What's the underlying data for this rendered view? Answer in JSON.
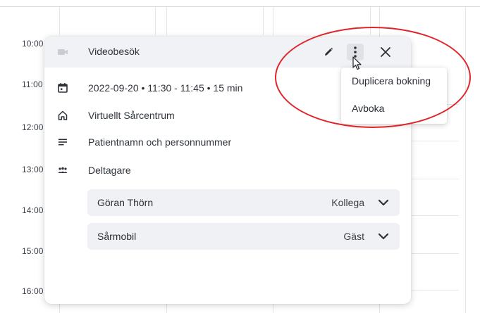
{
  "calendar": {
    "times": [
      "10:00",
      "11:00",
      "12:00",
      "13:00",
      "14:00",
      "15:00",
      "16:00"
    ]
  },
  "popup": {
    "title": "Videobesök",
    "datetime": "2022-09-20 • 11:30 - 11:45 • 15 min",
    "location": "Virtuellt Sårcentrum",
    "patient": "Patientnamn och personnummer",
    "participants_label": "Deltagare",
    "participants": [
      {
        "name": "Göran Thörn",
        "role": "Kollega"
      },
      {
        "name": "Sårmobil",
        "role": "Gäst"
      }
    ]
  },
  "menu": {
    "items": [
      "Duplicera bokning",
      "Avboka"
    ]
  },
  "icons": {
    "video": "video-camera-icon",
    "calendar": "calendar-icon",
    "home": "home-icon",
    "notes": "notes-icon",
    "participants": "people-icon",
    "edit": "pencil-icon",
    "more": "kebab-menu-icon",
    "close": "close-icon",
    "expand": "chevron-down-icon"
  },
  "colors": {
    "header_bg": "#f1f2f6",
    "participant_bg": "#f0f1f5",
    "annotation": "#e0242a"
  }
}
